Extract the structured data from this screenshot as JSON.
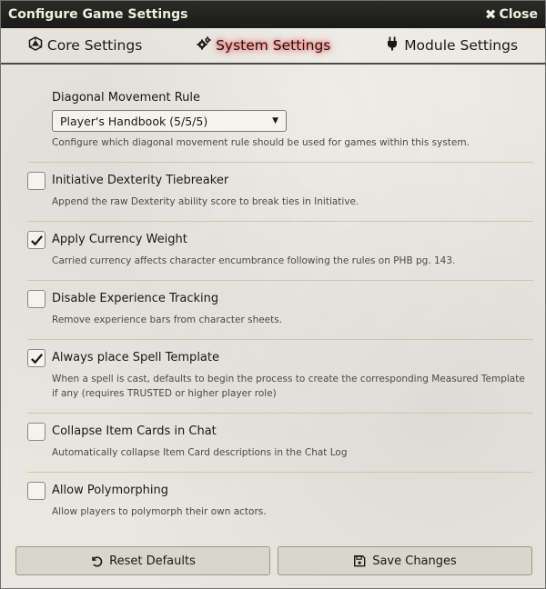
{
  "window": {
    "title": "Configure Game Settings",
    "close_label": "Close"
  },
  "tabs": [
    {
      "label": "Core Settings",
      "icon": "d20-icon",
      "active": false
    },
    {
      "label": "System Settings",
      "icon": "cogs-icon",
      "active": true
    },
    {
      "label": "Module Settings",
      "icon": "plug-icon",
      "active": false
    }
  ],
  "settings": {
    "diagonal": {
      "label": "Diagonal Movement Rule",
      "value": "Player's Handbook (5/5/5)",
      "hint": "Configure which diagonal movement rule should be used for games within this system."
    },
    "items": [
      {
        "label": "Initiative Dexterity Tiebreaker",
        "checked": false,
        "hint": "Append the raw Dexterity ability score to break ties in Initiative."
      },
      {
        "label": "Apply Currency Weight",
        "checked": true,
        "hint": "Carried currency affects character encumbrance following the rules on PHB pg. 143."
      },
      {
        "label": "Disable Experience Tracking",
        "checked": false,
        "hint": "Remove experience bars from character sheets."
      },
      {
        "label": "Always place Spell Template",
        "checked": true,
        "hint": "When a spell is cast, defaults to begin the process to create the corresponding Measured Template if any (requires TRUSTED or higher player role)"
      },
      {
        "label": "Collapse Item Cards in Chat",
        "checked": false,
        "hint": "Automatically collapse Item Card descriptions in the Chat Log"
      },
      {
        "label": "Allow Polymorphing",
        "checked": false,
        "hint": "Allow players to polymorph their own actors."
      }
    ]
  },
  "footer": {
    "reset_label": "Reset Defaults",
    "save_label": "Save Changes"
  },
  "colors": {
    "titlebar": "#222220",
    "background": "#e9e7df",
    "active_glow": "#ff4040",
    "text": "#191813"
  }
}
